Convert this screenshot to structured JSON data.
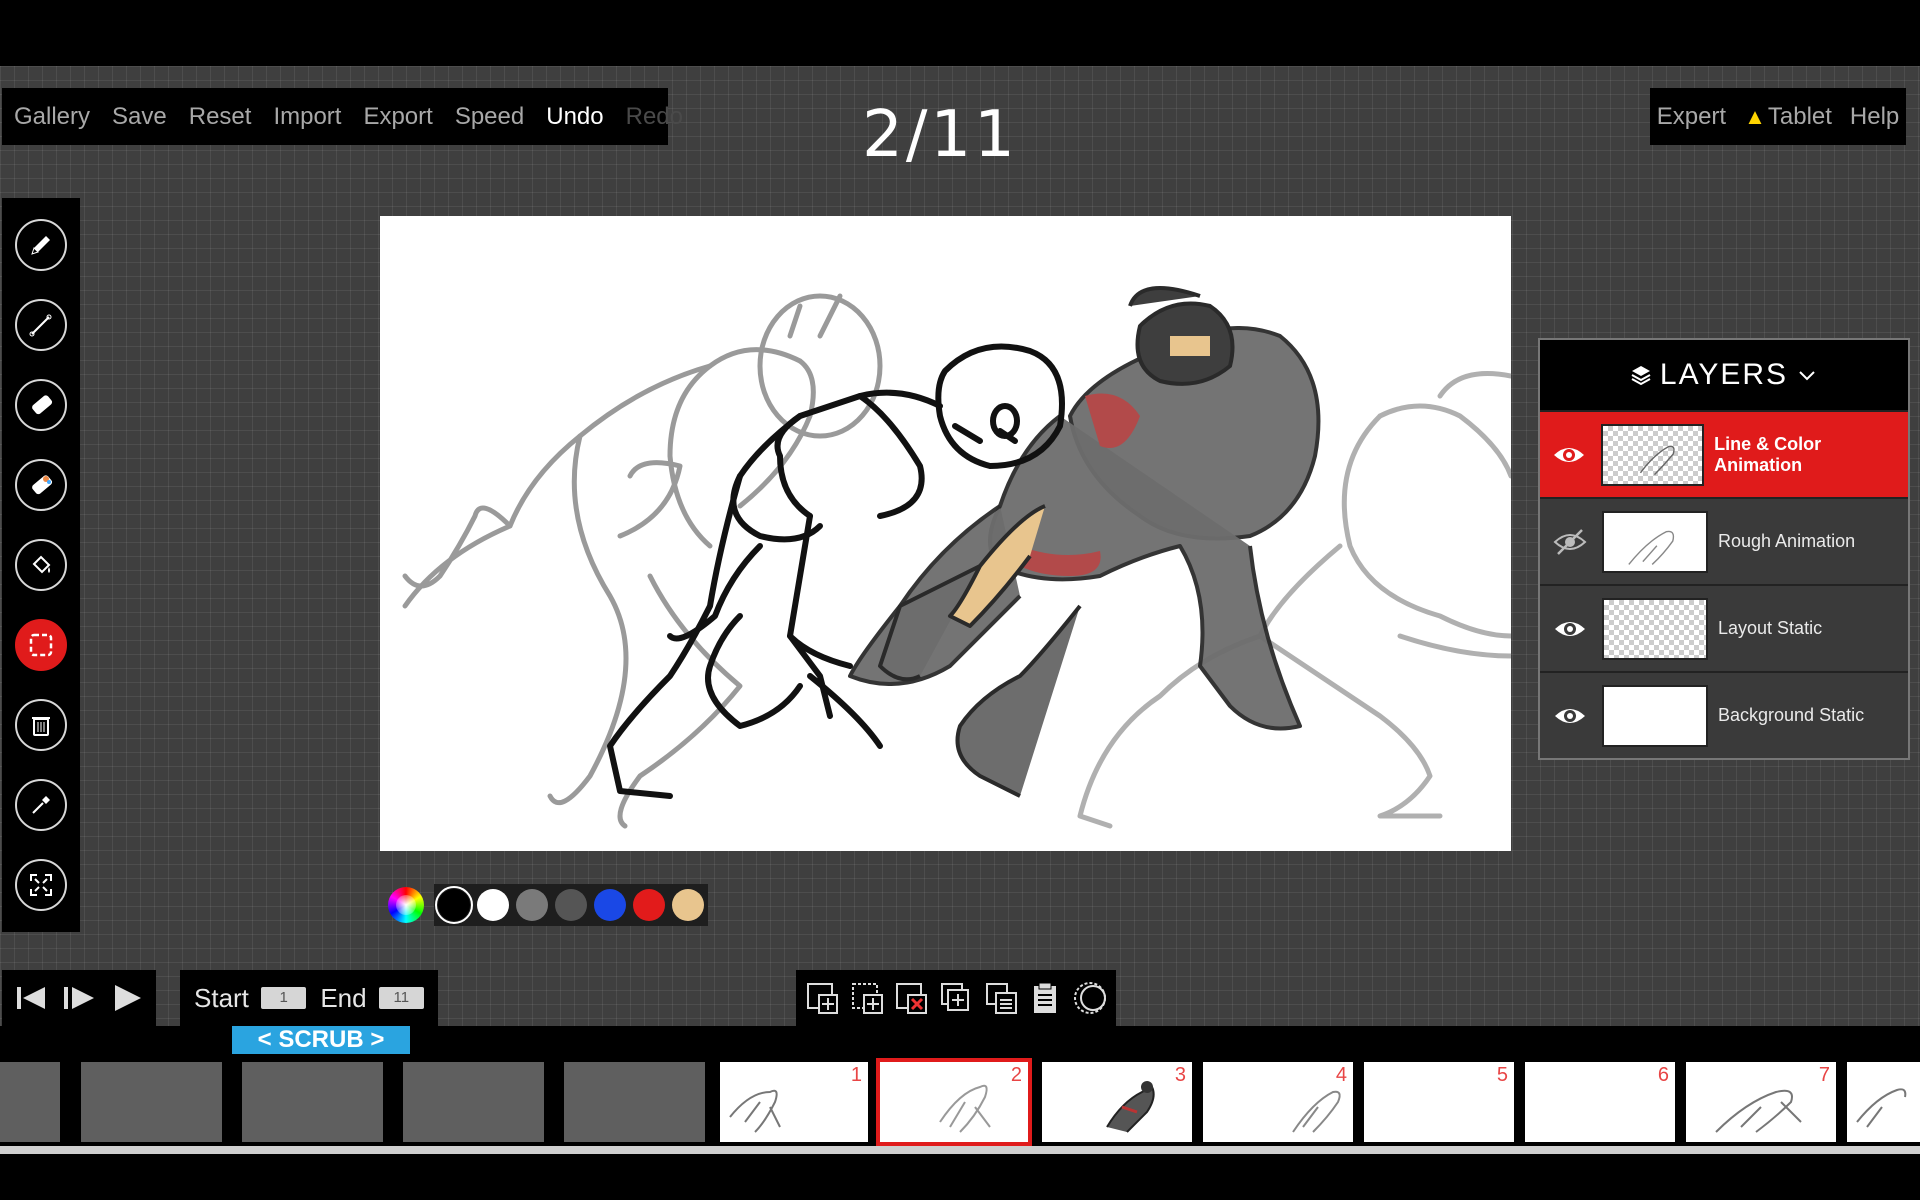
{
  "menu": {
    "gallery": "Gallery",
    "save": "Save",
    "reset": "Reset",
    "import": "Import",
    "export": "Export",
    "speed": "Speed",
    "undo": "Undo",
    "redo": "Redo"
  },
  "top_right": {
    "expert": "Expert",
    "tablet": "Tablet",
    "help": "Help",
    "warning_icon": "warning-icon"
  },
  "frame_counter": "2/11",
  "tools": [
    {
      "name": "pencil-icon"
    },
    {
      "name": "line-icon"
    },
    {
      "name": "eraser-icon"
    },
    {
      "name": "color-eraser-icon"
    },
    {
      "name": "fill-bucket-icon"
    },
    {
      "name": "select-icon",
      "selected": true
    },
    {
      "name": "trash-icon"
    },
    {
      "name": "eyedropper-icon"
    },
    {
      "name": "fullscreen-icon"
    }
  ],
  "palette": {
    "colors": [
      "#000000",
      "#ffffff",
      "#7a7a7a",
      "#555555",
      "#1a48e6",
      "#e21b1b",
      "#e8c58e"
    ],
    "selected_index": 0
  },
  "range": {
    "start_label": "Start",
    "start_value": "1",
    "end_label": "End",
    "end_value": "11"
  },
  "scrub_label": "< SCRUB >",
  "timeline": {
    "current_frame": 2,
    "frames": [
      "1",
      "2",
      "3",
      "4",
      "5",
      "6",
      "7"
    ]
  },
  "layers": {
    "title": "LAYERS",
    "items": [
      {
        "label": "Line & Color Animation",
        "visible": true,
        "active": true
      },
      {
        "label": "Rough Animation",
        "visible": false,
        "active": false
      },
      {
        "label": "Layout Static",
        "visible": true,
        "active": false
      },
      {
        "label": "Background Static",
        "visible": true,
        "active": false
      }
    ]
  },
  "colors": {
    "accent_red": "#e01b1b",
    "scrub_blue": "#2aa4e0",
    "workspace": "#3f3f3f"
  }
}
